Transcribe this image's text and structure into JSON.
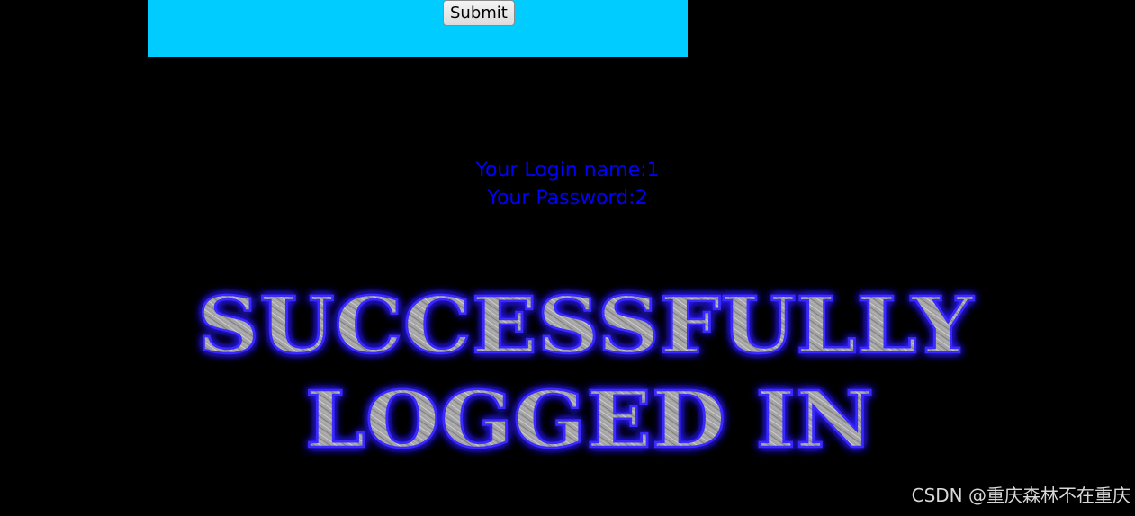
{
  "form": {
    "submit_label": "Submit",
    "panel_color": "#00ccff"
  },
  "result": {
    "login_name_line": "Your Login name:1",
    "password_line": "Your Password:2",
    "text_color": "#0000ff"
  },
  "banner": {
    "line1": "SUCCESSFULLY",
    "line2": "LOGGED IN",
    "glow_color": "#2a1cff",
    "metal_color": "#a9a9a9"
  },
  "watermark": {
    "text": "CSDN @重庆森林不在重庆"
  }
}
